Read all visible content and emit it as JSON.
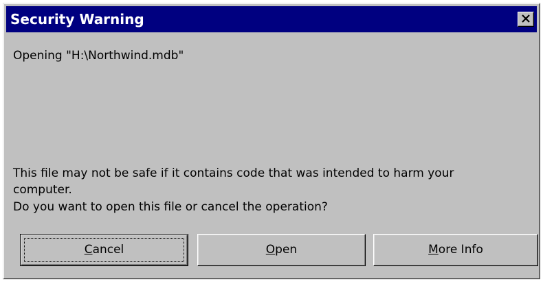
{
  "dialog": {
    "title": "Security Warning",
    "opening_text": "Opening \"H:\\Northwind.mdb\"",
    "warning_line1": "This file may not be safe if it contains code that was intended to harm your",
    "warning_line2": "computer.",
    "question": "Do you want to open this file or cancel the operation?"
  },
  "buttons": {
    "cancel": {
      "access_key": "C",
      "rest": "ancel"
    },
    "open": {
      "access_key": "O",
      "rest": "pen"
    },
    "more_info": {
      "access_key": "M",
      "rest": "ore Info"
    }
  },
  "icons": {
    "close": "close-icon"
  },
  "colors": {
    "titlebar": "#000080",
    "dialog_face": "#c0c0c0",
    "title_text": "#ffffff"
  }
}
